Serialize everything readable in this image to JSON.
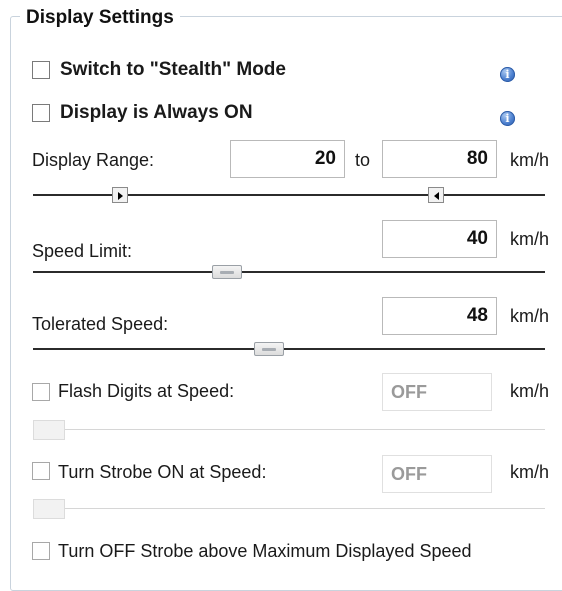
{
  "group": {
    "title": "Display Settings"
  },
  "stealth": {
    "label": "Switch to \"Stealth\" Mode",
    "checked": false,
    "info_icon": "info-icon"
  },
  "always_on": {
    "label": "Display is Always ON",
    "checked": false,
    "info_icon": "info-icon"
  },
  "display_range": {
    "label": "Display Range:",
    "min_value": "20",
    "to_label": "to",
    "max_value": "80",
    "unit": "km/h"
  },
  "speed_limit": {
    "label": "Speed Limit:",
    "value": "40",
    "unit": "km/h"
  },
  "tolerated_speed": {
    "label": "Tolerated Speed:",
    "value": "48",
    "unit": "km/h"
  },
  "flash_digits": {
    "label": "Flash Digits at Speed:",
    "value": "OFF",
    "unit": "km/h",
    "checked": false
  },
  "strobe_on": {
    "label": "Turn Strobe ON at Speed:",
    "value": "OFF",
    "unit": "km/h",
    "checked": false
  },
  "strobe_off": {
    "label": "Turn OFF Strobe above Maximum Displayed Speed",
    "checked": false
  }
}
